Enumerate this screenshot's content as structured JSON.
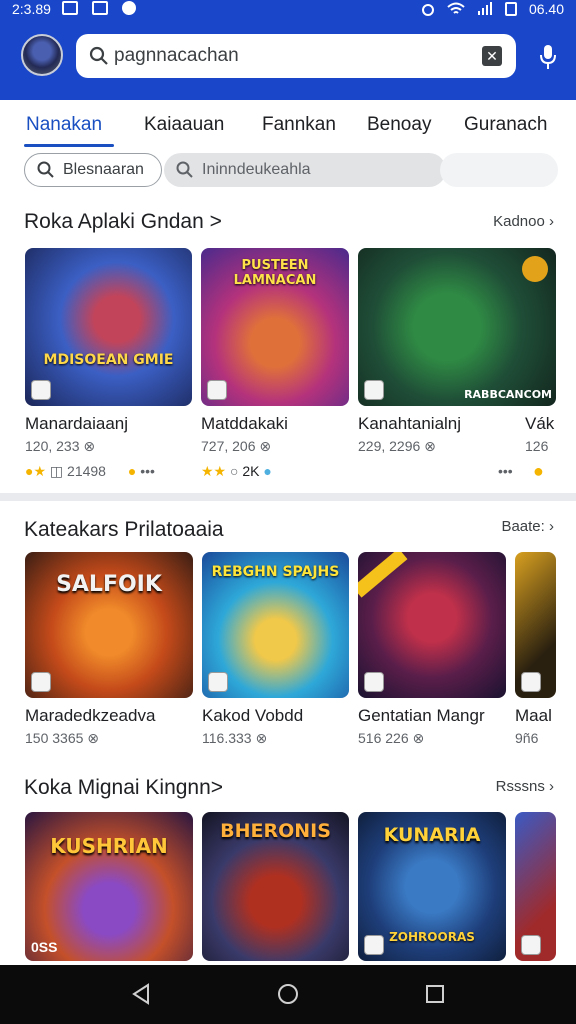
{
  "status_bar": {
    "time": "2:3.89",
    "clock": "06.40"
  },
  "colors": {
    "header": "#1a47c9",
    "accent": "#1a4fc2",
    "star": "#f4b400"
  },
  "search": {
    "value": "pagnnacachan",
    "icon": "search-icon"
  },
  "tabs": [
    {
      "label": "Nanakan",
      "active": true
    },
    {
      "label": "Kaiaauan",
      "active": false
    },
    {
      "label": "Fannkan",
      "active": false
    },
    {
      "label": "Benoay",
      "active": false
    },
    {
      "label": "Guranach",
      "active": false
    }
  ],
  "chips": [
    {
      "label": "Blesnaaran"
    },
    {
      "label": "Ininndeukeahla"
    }
  ],
  "sections": [
    {
      "title": "Roka Aplaki Gndan >",
      "more": "Kadnoo",
      "cards": [
        {
          "caption": "MDISOEAN GMIE",
          "name": "Manardaiaanj",
          "sub": "120, 233",
          "rating_text": "21498"
        },
        {
          "caption": "PUSTEEN LAMNACAN",
          "name": "Matddakaki",
          "sub": "727, 206",
          "rating_text": "2K"
        },
        {
          "caption": "RABBCANCOM",
          "name": "Kanahtanialnj",
          "sub": "229, 2296"
        },
        {
          "caption": "",
          "name": "Vák",
          "sub": "126"
        }
      ]
    },
    {
      "title": "Kateakars Prilatoaaia",
      "more": "Baate:",
      "cards": [
        {
          "caption": "SALFOIK",
          "name": "Maradedkzeadva",
          "sub": "150 3365"
        },
        {
          "caption": "REBGHN SPAJHS",
          "name": "Kakod Vobdd",
          "sub": "116.333"
        },
        {
          "caption": "",
          "name": "Gentatian Mangr",
          "sub": "516 226"
        },
        {
          "caption": "",
          "name": "Maal",
          "sub": "9ñ6"
        }
      ]
    },
    {
      "title": "Koka Mignai Kingnn>",
      "more": "Rsssns",
      "cards": [
        {
          "caption": "KUSHRIAN",
          "corner": "0SS"
        },
        {
          "caption": "BHERONIS"
        },
        {
          "caption": "KUNARIA",
          "caption2": "ZOHROORAS"
        },
        {
          "caption": ""
        }
      ]
    }
  ]
}
